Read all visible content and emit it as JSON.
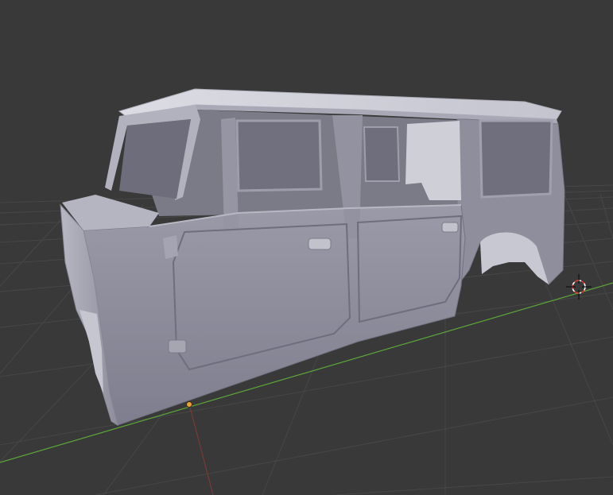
{
  "app": "3D viewport",
  "scene": {
    "object": "vehicle-body",
    "shading": "solid",
    "grid": true,
    "axes": {
      "x_color": "#c0413a",
      "y_color": "#5da63a"
    },
    "cursor": "3d-cursor-icon",
    "origin": "object-origin-point"
  },
  "colors": {
    "background": "#393939",
    "grid_line": "#4a4a4a",
    "body_side": "#8a8a9a",
    "body_top": "#d6d6de",
    "body_dark": "#6c6c7a",
    "window_interior": "#7b7b88"
  }
}
